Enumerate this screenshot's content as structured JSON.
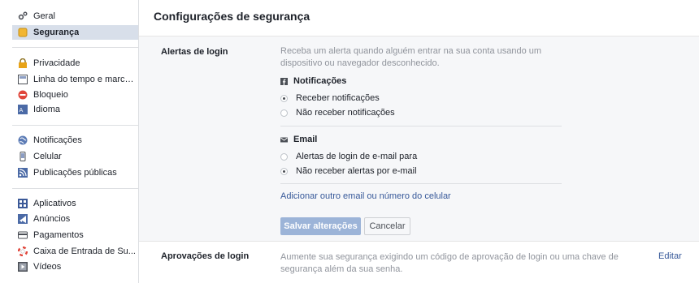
{
  "sidebar": {
    "items": [
      {
        "label": "Geral",
        "icon": "gears-icon"
      },
      {
        "label": "Segurança",
        "icon": "shield-icon",
        "active": true
      },
      {
        "label": "Privacidade",
        "icon": "lock-icon"
      },
      {
        "label": "Linha do tempo e marca...",
        "icon": "timeline-icon"
      },
      {
        "label": "Bloqueio",
        "icon": "block-icon"
      },
      {
        "label": "Idioma",
        "icon": "language-icon"
      },
      {
        "label": "Notificações",
        "icon": "globe-icon"
      },
      {
        "label": "Celular",
        "icon": "mobile-icon"
      },
      {
        "label": "Publicações públicas",
        "icon": "rss-icon"
      },
      {
        "label": "Aplicativos",
        "icon": "apps-icon"
      },
      {
        "label": "Anúncios",
        "icon": "ads-icon"
      },
      {
        "label": "Pagamentos",
        "icon": "payments-icon"
      },
      {
        "label": "Caixa de Entrada de Su...",
        "icon": "lifebuoy-icon"
      },
      {
        "label": "Vídeos",
        "icon": "video-icon"
      }
    ]
  },
  "main": {
    "title": "Configurações de segurança",
    "login_alerts": {
      "label": "Alertas de login",
      "description": "Receba um alerta quando alguém entrar na sua conta usando um dispositivo ou navegador desconhecido.",
      "notifications_heading": "Notificações",
      "notifications_options": [
        "Receber notificações",
        "Não receber notificações"
      ],
      "notifications_selected": 0,
      "email_heading": "Email",
      "email_options": [
        "Alertas de login de e-mail para",
        "Não receber alertas por e-mail"
      ],
      "email_selected": 1,
      "add_link": "Adicionar outro email ou número do celular",
      "save_label": "Salvar alterações",
      "cancel_label": "Cancelar"
    },
    "login_approvals": {
      "label": "Aprovações de login",
      "description": "Aumente sua segurança exigindo um código de aprovação de login ou uma chave de segurança além da sua senha.",
      "edit_label": "Editar"
    }
  }
}
